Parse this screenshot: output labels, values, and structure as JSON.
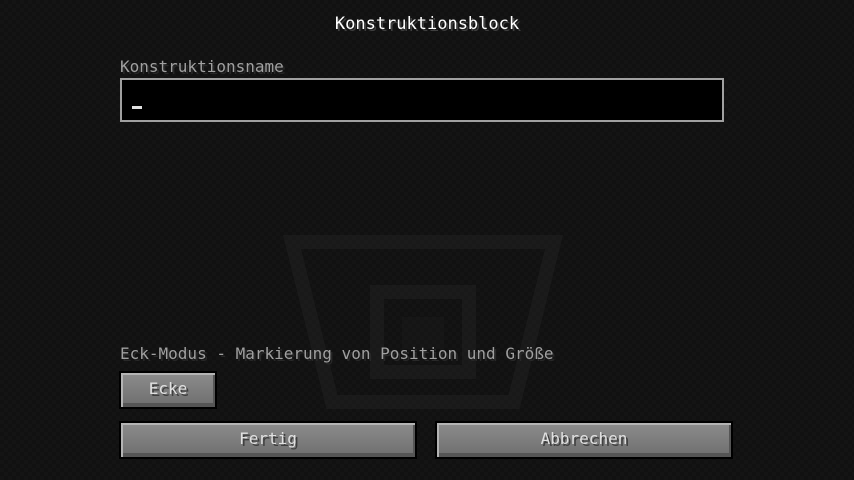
{
  "screen": {
    "title": "Konstruktionsblock"
  },
  "name_field": {
    "label": "Konstruktionsname",
    "value": ""
  },
  "mode": {
    "description": "Eck-Modus - Markierung von Position und Größe",
    "button_label": "Ecke"
  },
  "actions": {
    "done_label": "Fertig",
    "cancel_label": "Abbrechen"
  },
  "icons": {
    "watermark": "structure-block-icon"
  },
  "colors": {
    "background": "#101010",
    "label": "#a0a0a0",
    "title": "#ffffff",
    "button": "#6f6f6f",
    "input_border": "#a0a0a0"
  }
}
